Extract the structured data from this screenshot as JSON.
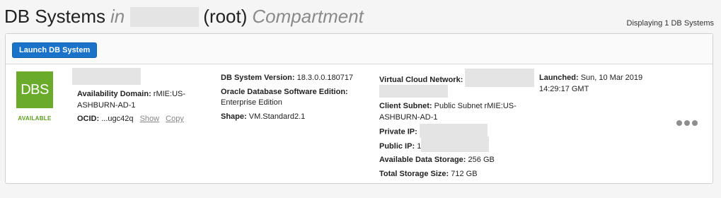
{
  "header": {
    "title_main": "DB Systems",
    "title_in": "in",
    "title_root": "(root)",
    "title_compartment": "Compartment",
    "count_text": "Displaying 1 DB Systems"
  },
  "toolbar": {
    "launch_label": "Launch DB System"
  },
  "db_system": {
    "icon_text": "DBS",
    "state": "AVAILABLE",
    "state_color": "#6aab2b",
    "availability_domain_label": "Availability Domain:",
    "availability_domain_value": "rMIE:US-ASHBURN-AD-1",
    "ocid_label": "OCID:",
    "ocid_value": "...ugc42q",
    "show_label": "Show",
    "copy_label": "Copy",
    "version_label": "DB System Version:",
    "version_value": "18.3.0.0.180717",
    "edition_label": "Oracle Database Software Edition:",
    "edition_value": "Enterprise Edition",
    "shape_label": "Shape:",
    "shape_value": "VM.Standard2.1",
    "vcn_label": "Virtual Cloud Network:",
    "subnet_label": "Client Subnet:",
    "subnet_value": "Public Subnet rMIE:US-ASHBURN-AD-1",
    "private_ip_label": "Private IP:",
    "public_ip_label": "Public IP:",
    "public_ip_partial": "1",
    "data_storage_label": "Available Data Storage:",
    "data_storage_value": "256 GB",
    "total_storage_label": "Total Storage Size:",
    "total_storage_value": "712 GB",
    "launched_label": "Launched:",
    "launched_value": "Sun, 10 Mar 2019 14:29:17 GMT",
    "actions_icon": "more-actions-icon"
  },
  "colors": {
    "primary_button": "#1a73c8",
    "available_green": "#6aab2b"
  }
}
